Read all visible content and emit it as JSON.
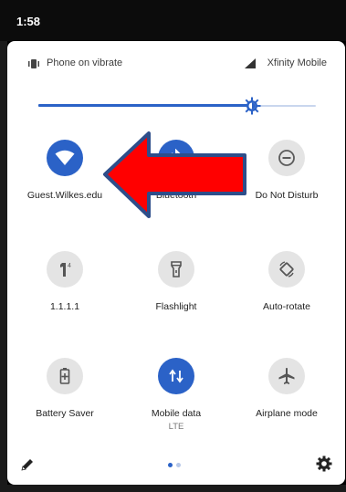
{
  "status_bar": {
    "time": "1:58"
  },
  "header": {
    "ringer_status": "Phone on vibrate",
    "carrier": "Xfinity Mobile"
  },
  "brightness": {
    "level": 0.77
  },
  "tiles": [
    {
      "label": "Guest.Wilkes.edu",
      "icon": "wifi-icon",
      "active": true
    },
    {
      "label": "Bluetooth",
      "icon": "bluetooth-icon",
      "active": true
    },
    {
      "label": "Do Not Disturb",
      "icon": "do-not-disturb-icon",
      "active": false
    },
    {
      "label": "1.1.1.1",
      "icon": "vpn-1111-icon",
      "active": false
    },
    {
      "label": "Flashlight",
      "icon": "flashlight-icon",
      "active": false
    },
    {
      "label": "Auto-rotate",
      "icon": "auto-rotate-icon",
      "active": false
    },
    {
      "label": "Battery Saver",
      "icon": "battery-saver-icon",
      "active": false
    },
    {
      "label": "Mobile data",
      "sublabel": "LTE",
      "icon": "mobile-data-icon",
      "active": true
    },
    {
      "label": "Airplane mode",
      "icon": "airplane-icon",
      "active": false
    }
  ],
  "pager": {
    "pages": 2,
    "current": 1
  },
  "colors": {
    "accent": "#2b62c7",
    "tile_off": "#e4e4e4",
    "annotation_arrow": "#ff0000",
    "arrow_outline": "#2e4e8a"
  }
}
